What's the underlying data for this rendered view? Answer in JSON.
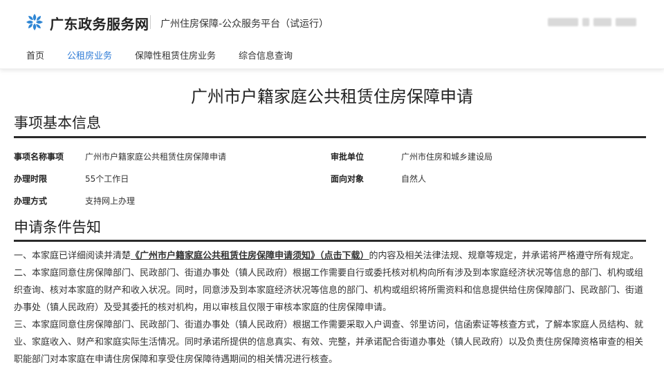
{
  "header": {
    "site_name": "广东政务服务网",
    "platform_name": "广州住房保障-公众服务平台（试运行）",
    "nav": [
      {
        "label": "首页",
        "active": false
      },
      {
        "label": "公租房业务",
        "active": true
      },
      {
        "label": "保障性租赁住房业务",
        "active": false
      },
      {
        "label": "综合信息查询",
        "active": false
      }
    ],
    "accent_color": "#2e7bd6"
  },
  "page": {
    "title": "广州市户籍家庭公共租赁住房保障申请"
  },
  "basic_info": {
    "section_title": "事项基本信息",
    "items": [
      {
        "label": "事项名称事项",
        "value": "广州市户籍家庭公共租赁住房保障申请"
      },
      {
        "label": "审批单位",
        "value": "广州市住房和城乡建设局"
      },
      {
        "label": "办理时限",
        "value": "55个工作日"
      },
      {
        "label": "面向对象",
        "value": "自然人"
      },
      {
        "label": "办理方式",
        "value": "支持网上办理"
      }
    ]
  },
  "conditions": {
    "section_title": "申请条件告知",
    "p1_before": "一、本家庭已详细阅读并清楚",
    "p1_link": "《广州市户籍家庭公共租赁住房保障申请须知》（点击下载）",
    "p1_after": "的内容及相关法律法规、规章等规定，并承诺将严格遵守所有规定。",
    "p2": "二、本家庭同意住房保障部门、民政部门、街道办事处（镇人民政府）根据工作需要自行或委托核对机构向所有涉及到本家庭经济状况等信息的部门、机构或组织查询、核对本家庭的财产和收入状况。同时，同意涉及到本家庭经济状况等信息的部门、机构或组织将所需资料和信息提供给住房保障部门、民政部门、街道办事处（镇人民政府）及受其委托的核对机构，用以审核且仅限于审核本家庭的住房保障申请。",
    "p3": "三、本家庭同意住房保障部门、民政部门、街道办事处（镇人民政府）根据工作需要采取入户调查、邻里访问，信函索证等核查方式，了解本家庭人员结构、就业、家庭收入、财产和家庭实际生活情况。同时承诺所提供的信息真实、有效、完整，并承诺配合街道办事处（镇人民政府）以及负责住房保障资格审查的相关职能部门对本家庭在申请住房保障和享受住房保障待遇期间的相关情况进行核查。"
  }
}
